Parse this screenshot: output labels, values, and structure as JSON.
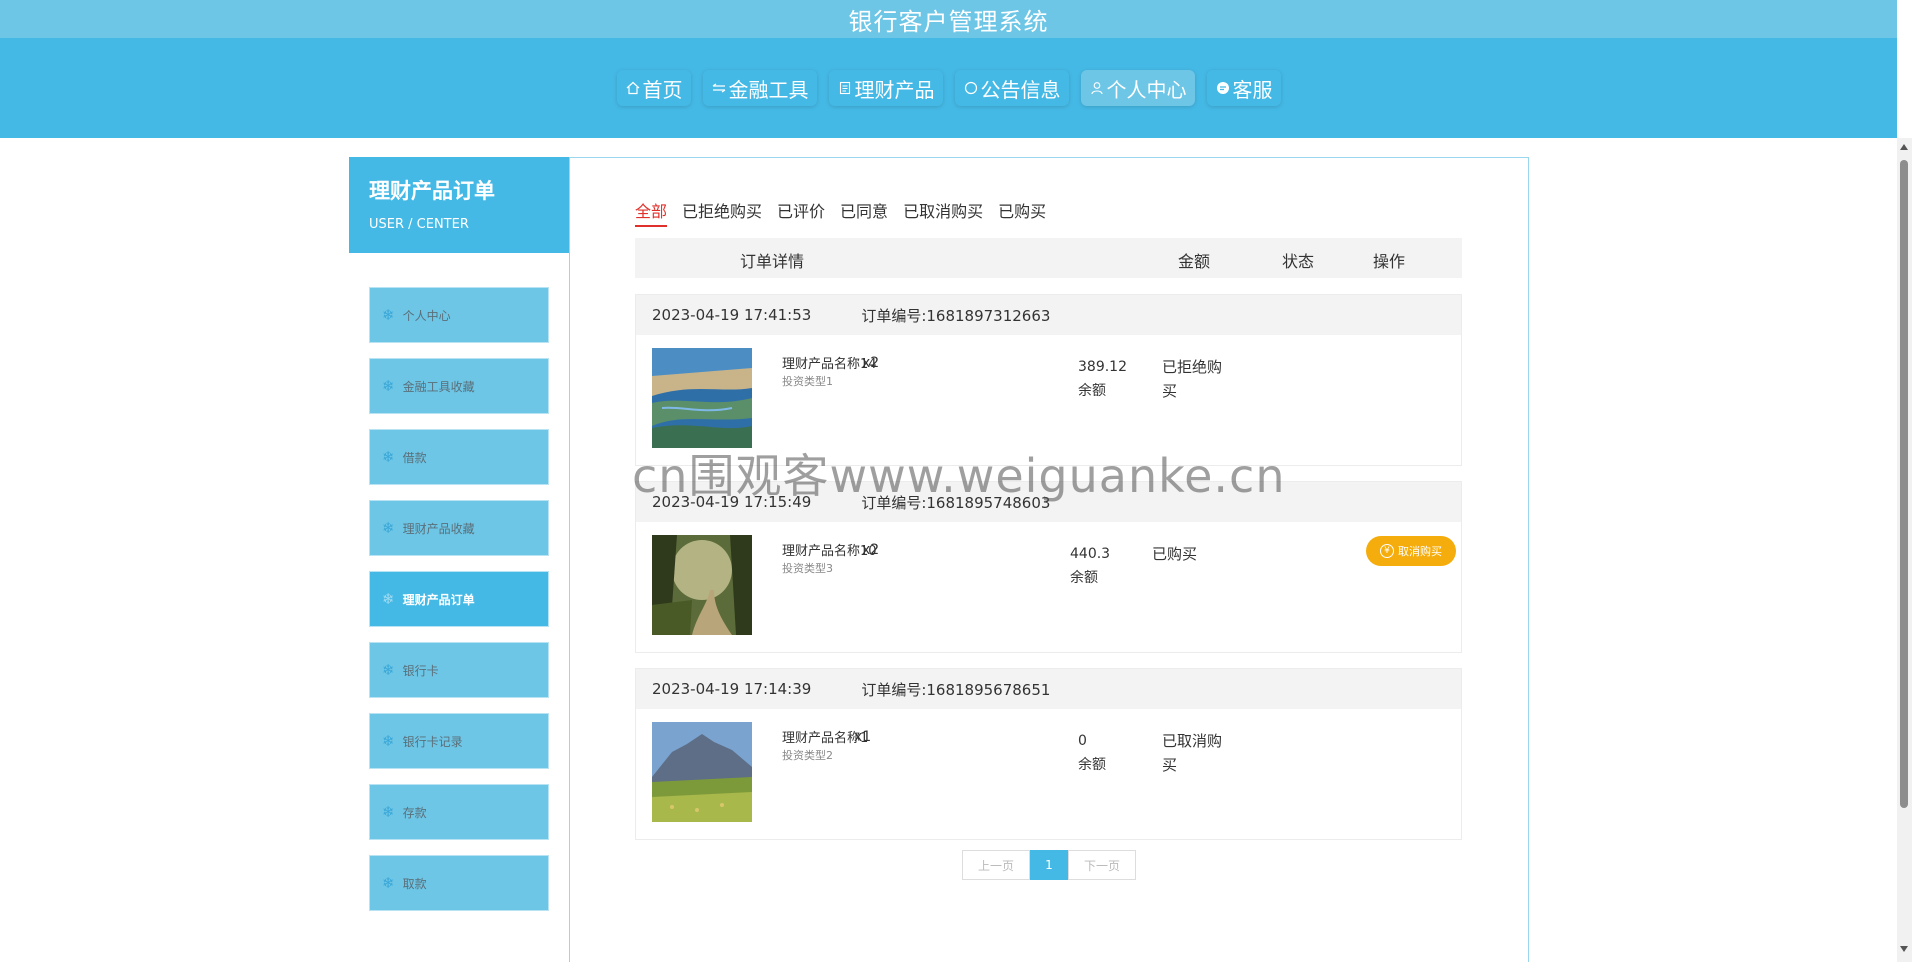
{
  "app": {
    "title": "银行客户管理系统"
  },
  "nav": [
    {
      "label": "首页",
      "icon": "home-icon"
    },
    {
      "label": "金融工具",
      "icon": "filter-icon"
    },
    {
      "label": "理财产品",
      "icon": "document-icon"
    },
    {
      "label": "公告信息",
      "icon": "circle-icon"
    },
    {
      "label": "个人中心",
      "icon": "user-icon",
      "active": true
    },
    {
      "label": "客服",
      "icon": "chat-icon"
    }
  ],
  "sidebar": {
    "title": "理财产品订单",
    "subtitle": "USER / CENTER",
    "items": [
      {
        "label": "个人中心"
      },
      {
        "label": "金融工具收藏"
      },
      {
        "label": "借款"
      },
      {
        "label": "理财产品收藏"
      },
      {
        "label": "理财产品订单",
        "active": true
      },
      {
        "label": "银行卡"
      },
      {
        "label": "银行卡记录"
      },
      {
        "label": "存款"
      },
      {
        "label": "取款"
      }
    ]
  },
  "tabs": [
    "全部",
    "已拒绝购买",
    "已评价",
    "已同意",
    "已取消购买",
    "已购买"
  ],
  "table_headers": {
    "detail": "订单详情",
    "amount": "金额",
    "status": "状态",
    "action": "操作"
  },
  "orders": [
    {
      "time": "2023-04-19 17:41:53",
      "order_no": "订单编号:1681897312663",
      "product": "理财产品名称14",
      "type": "投资类型1",
      "qty": "x2",
      "amount": "389.12",
      "amount_unit": "余额",
      "status": "已拒绝购买",
      "image": "coastal-wetland"
    },
    {
      "time": "2023-04-19 17:15:49",
      "order_no": "订单编号:1681895748603",
      "product": "理财产品名称10",
      "type": "投资类型3",
      "qty": "x2",
      "amount": "440.3",
      "amount_unit": "余额",
      "status": "已购买",
      "action": "取消购买",
      "image": "misty-forest-path"
    },
    {
      "time": "2023-04-19 17:14:39",
      "order_no": "订单编号:1681895678651",
      "product": "理财产品名称1",
      "type": "投资类型2",
      "qty": "x1",
      "amount": "0",
      "amount_unit": "余额",
      "status": "已取消购买",
      "image": "mountain-meadow"
    }
  ],
  "pager": {
    "prev": "上一页",
    "current": "1",
    "next": "下一页"
  },
  "watermark": "cn围观客www.weiguanke.cn",
  "colors": {
    "primary": "#45b9e5",
    "light": "#6ec6e6",
    "accent_red": "#e0302b",
    "button_orange": "#f5ad0d"
  }
}
